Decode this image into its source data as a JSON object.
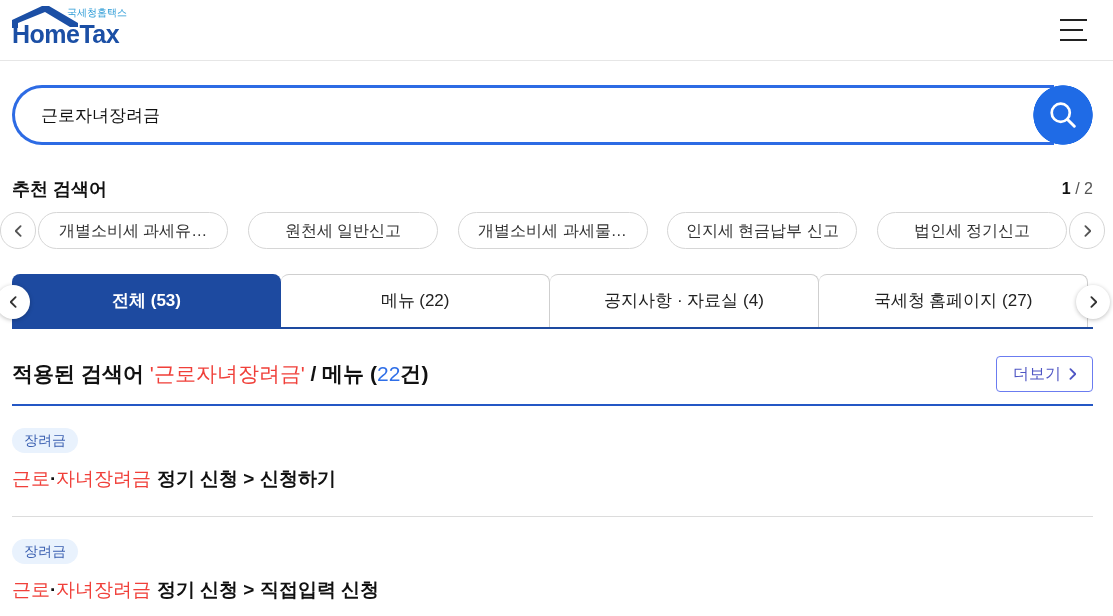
{
  "header": {
    "logo_subtitle": "국세청홈택스",
    "logo_text": "HomeTax"
  },
  "search": {
    "value": "근로자녀장려금"
  },
  "recommended": {
    "title": "추천 검색어",
    "pager": "**1** / 2",
    "keywords": [
      "개별소비세 과세유…",
      "원천세 일반신고",
      "개별소비세 과세물…",
      "인지세 현금납부 신고",
      "법인세 정기신고"
    ]
  },
  "tabs": [
    {
      "label": "전체 (53)",
      "selected": true
    },
    {
      "label": "메뉴 (22)",
      "selected": false
    },
    {
      "label": "공지사항 · 자료실 (4)",
      "selected": false
    },
    {
      "label": "국세청 홈페이지 (27)",
      "selected": false
    }
  ],
  "results": {
    "heading": [
      {
        "kind": "text",
        "text": "적용된 검색어 "
      },
      {
        "kind": "keyword",
        "text": "'근로자녀장려금'"
      },
      {
        "kind": "text",
        "text": " / 메뉴 ("
      },
      {
        "kind": "count",
        "text": "22"
      },
      {
        "kind": "text",
        "text": "건)"
      }
    ],
    "more_button": "더보기",
    "items": [
      {
        "tag": "장려금",
        "title": [
          {
            "text": "근로",
            "highlight": true
          },
          {
            "text": "·",
            "highlight": false
          },
          {
            "text": "자녀장려금",
            "highlight": true
          },
          {
            "text": " 정기 신청 > 신청하기",
            "highlight": false
          }
        ]
      },
      {
        "tag": "장려금",
        "title": [
          {
            "text": "근로",
            "highlight": true
          },
          {
            "text": "·",
            "highlight": false
          },
          {
            "text": "자녀장려금",
            "highlight": true
          },
          {
            "text": " 정기 신청 > 직접입력 신청",
            "highlight": false
          }
        ]
      }
    ]
  }
}
